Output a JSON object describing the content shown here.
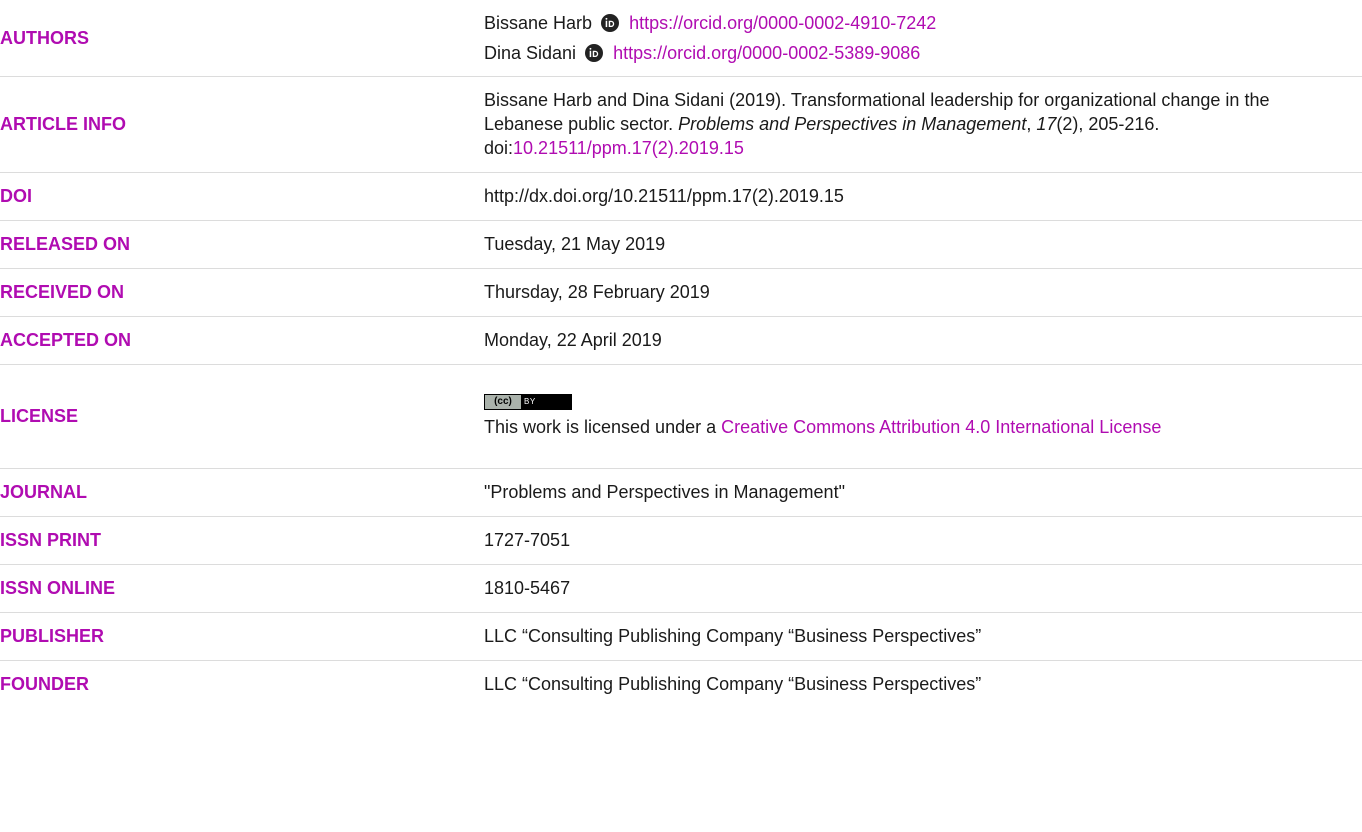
{
  "authors": {
    "label": "AUTHORS",
    "list": [
      {
        "name": "Bissane Harb",
        "orcid": "https://orcid.org/0000-0002-4910-7242"
      },
      {
        "name": "Dina Sidani",
        "orcid": "https://orcid.org/0000-0002-5389-9086"
      }
    ]
  },
  "article_info": {
    "label": "ARTICLE INFO",
    "citation_prefix": "Bissane Harb and Dina Sidani (2019). Transformational leadership for organizational change in the Lebanese public sector. ",
    "journal_italic": "Problems and Perspectives in Management",
    "sep1": ", ",
    "volume_italic": "17",
    "issue_pages": "(2), 205-216. doi:",
    "doi_link": "10.21511/ppm.17(2).2019.15"
  },
  "doi": {
    "label": "DOI",
    "value": "http://dx.doi.org/10.21511/ppm.17(2).2019.15"
  },
  "released": {
    "label": "RELEASED ON",
    "value": "Tuesday, 21 May 2019"
  },
  "received": {
    "label": "RECEIVED ON",
    "value": "Thursday, 28 February 2019"
  },
  "accepted": {
    "label": "ACCEPTED ON",
    "value": "Monday, 22 April 2019"
  },
  "license": {
    "label": "LICENSE",
    "badge_left": "(cc)",
    "badge_right": "BY",
    "text_prefix": "This work is licensed under a ",
    "link_text": "Creative Commons Attribution 4.0 International License"
  },
  "journal": {
    "label": "JOURNAL",
    "value": "\"Problems and Perspectives in Management\""
  },
  "issn_print": {
    "label": "ISSN PRINT",
    "value": "1727-7051"
  },
  "issn_online": {
    "label": "ISSN ONLINE",
    "value": "1810-5467"
  },
  "publisher": {
    "label": "PUBLISHER",
    "value": "LLC “Consulting Publishing Company “Business Perspectives”"
  },
  "founder": {
    "label": "FOUNDER",
    "value": "LLC “Consulting Publishing Company “Business Perspectives”"
  },
  "colors": {
    "accent": "#b00cb1",
    "orcid": "#222222"
  },
  "icons": {
    "orcid": "orcid-icon",
    "license": "cc-by-badge-icon"
  }
}
